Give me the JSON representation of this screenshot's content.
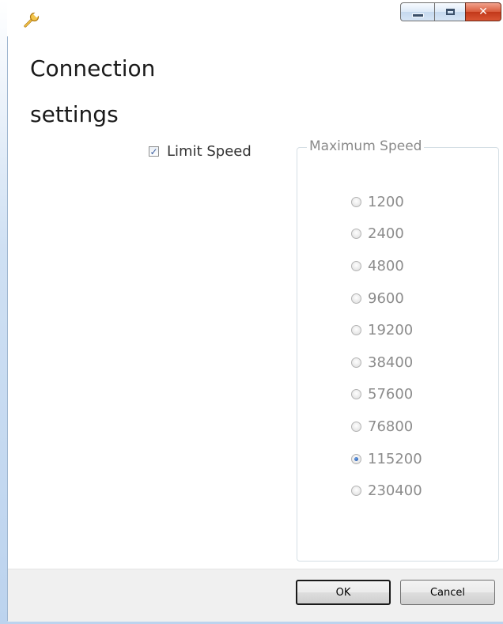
{
  "window": {
    "icon": "wrench-icon",
    "caption_buttons": [
      "minimize-icon",
      "maximize-icon",
      "close-icon"
    ]
  },
  "header": {
    "title_line1": "Connection",
    "title_line2": "settings"
  },
  "limit_speed": {
    "label": "Limit Speed",
    "checked": true
  },
  "speed_group": {
    "legend": "Maximum Speed",
    "options": [
      "1200",
      "2400",
      "4800",
      "9600",
      "19200",
      "38400",
      "57600",
      "76800",
      "115200",
      "230400"
    ],
    "selected": "115200",
    "enabled": false
  },
  "footer": {
    "ok_label": "OK",
    "cancel_label": "Cancel"
  },
  "colors": {
    "text_primary": "#1a1a1a",
    "text_disabled": "#8c8c8c",
    "footer_bg": "#f0f0f0",
    "close_button": "#c8442a"
  }
}
